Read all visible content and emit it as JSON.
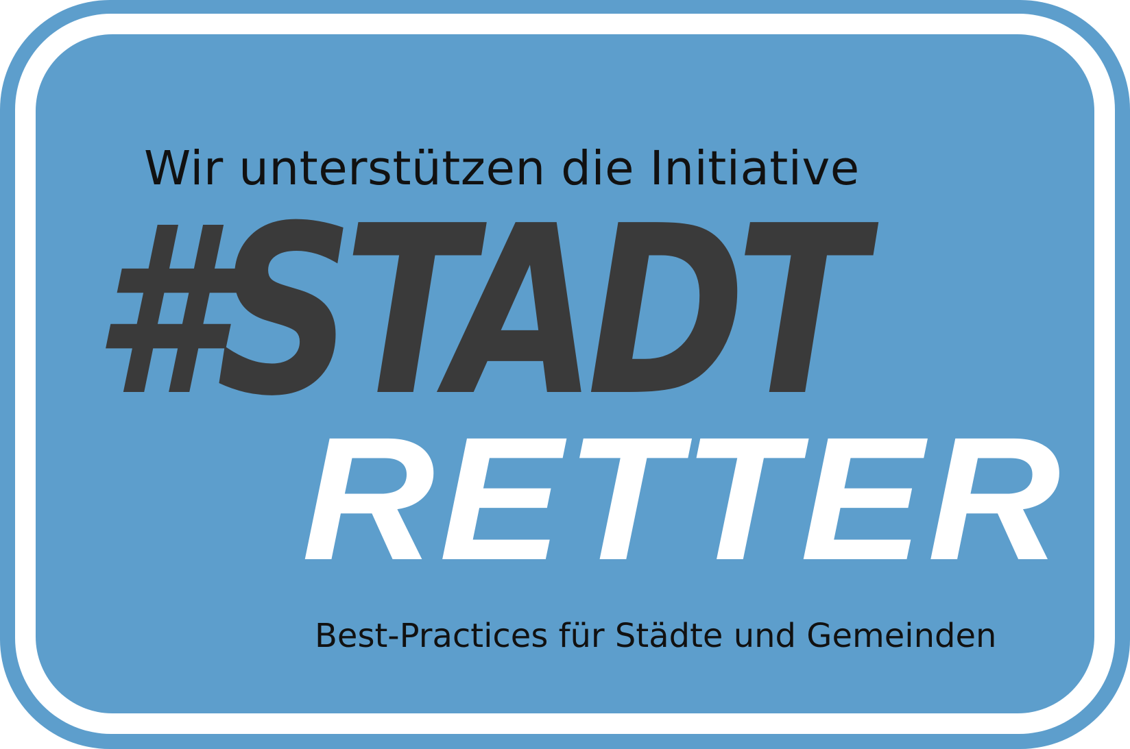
{
  "badge": {
    "headline": "Wir unterstützen die Initiative",
    "logo_top": "#STADT",
    "logo_bottom": "RETTER",
    "subline": "Best-Practices für Städte und Gemeinden"
  },
  "colors": {
    "background_blue": "#5d9ecc",
    "ring_white": "#ffffff",
    "logo_dark": "#3a3a3a",
    "text_black": "#111111"
  }
}
